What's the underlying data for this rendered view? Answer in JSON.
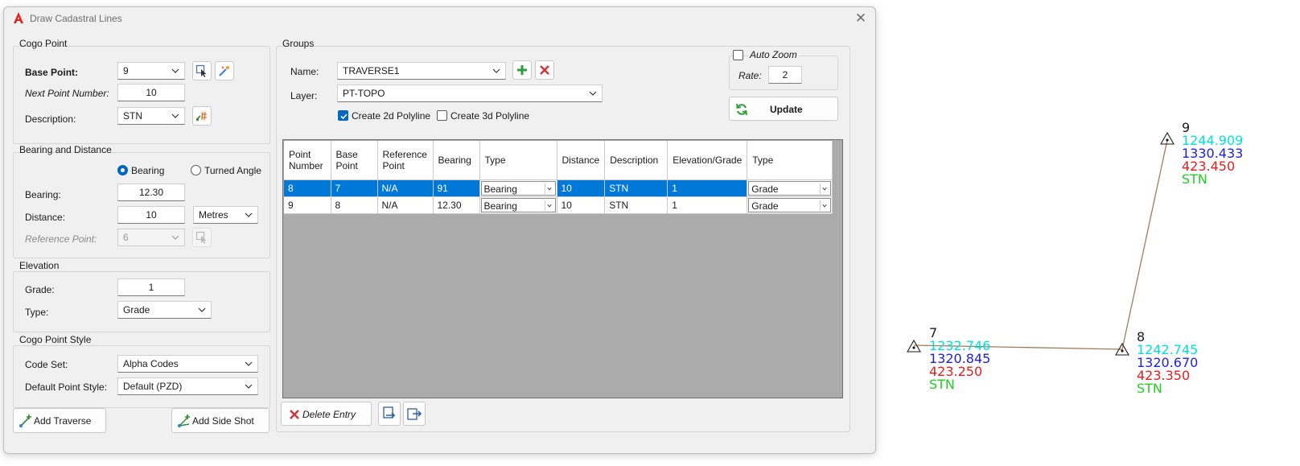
{
  "window": {
    "title": "Draw Cadastral Lines",
    "close_glyph": "✕"
  },
  "cogo_point": {
    "section_title": "Cogo Point",
    "base_point_label": "Base Point:",
    "base_point_value": "9",
    "next_point_label": "Next Point Number:",
    "next_point_value": "10",
    "description_label": "Description:",
    "description_value": "STN"
  },
  "bearing_distance": {
    "section_title": "Bearing and Distance",
    "radio_bearing": "Bearing",
    "radio_turned_angle": "Turned Angle",
    "selected_mode": "Bearing",
    "bearing_label": "Bearing:",
    "bearing_value": "12.30",
    "distance_label": "Distance:",
    "distance_value": "10",
    "units_value": "Metres",
    "reference_label": "Reference Point:",
    "reference_value": "6"
  },
  "elevation": {
    "section_title": "Elevation",
    "grade_label": "Grade:",
    "grade_value": "1",
    "type_label": "Type:",
    "type_value": "Grade"
  },
  "point_style": {
    "section_title": "Cogo Point Style",
    "code_set_label": "Code Set:",
    "code_set_value": "Alpha Codes",
    "default_style_label": "Default Point Style:",
    "default_style_value": "Default (PZD)"
  },
  "buttons": {
    "add_traverse": "Add Traverse",
    "add_side_shot": "Add Side Shot",
    "delete_entry": "Delete Entry",
    "update": "Update"
  },
  "groups": {
    "section_title": "Groups",
    "name_label": "Name:",
    "name_value": "TRAVERSE1",
    "layer_label": "Layer:",
    "layer_value": "PT-TOPO",
    "create_2d_label": "Create 2d Polyline",
    "create_2d_checked": true,
    "create_3d_label": "Create 3d Polyline",
    "create_3d_checked": false
  },
  "auto_zoom": {
    "label": "Auto Zoom",
    "checked": false,
    "rate_label": "Rate:",
    "rate_value": "2"
  },
  "grid": {
    "headers": [
      "Point\nNumber",
      "Base\nPoint",
      "Reference\nPoint",
      "Bearing",
      "Type",
      "Distance",
      "Description",
      "Elevation/Grade",
      "Type"
    ],
    "rows": [
      {
        "point": "8",
        "base": "7",
        "ref": "N/A",
        "bearing": "91",
        "type": "Bearing",
        "distance": "10",
        "desc": "STN",
        "elev": "1",
        "elev_type": "Grade",
        "selected": true
      },
      {
        "point": "9",
        "base": "8",
        "ref": "N/A",
        "bearing": "12.30",
        "type": "Bearing",
        "distance": "10",
        "desc": "STN",
        "elev": "1",
        "elev_type": "Grade",
        "selected": false
      }
    ]
  },
  "drawing": {
    "colors": {
      "line": "#a07c5a",
      "easting": "#00e0e0",
      "northing": "#2020e0",
      "elevation": "#e02020",
      "code": "#20d020",
      "number": "#1a1a1a"
    },
    "points": [
      {
        "number": "7",
        "easting": "1232.746",
        "northing": "1320.845",
        "elevation": "423.250",
        "code": "STN"
      },
      {
        "number": "8",
        "easting": "1242.745",
        "northing": "1320.670",
        "elevation": "423.350",
        "code": "STN"
      },
      {
        "number": "9",
        "easting": "1244.909",
        "northing": "1330.433",
        "elevation": "423.450",
        "code": "STN"
      }
    ]
  }
}
